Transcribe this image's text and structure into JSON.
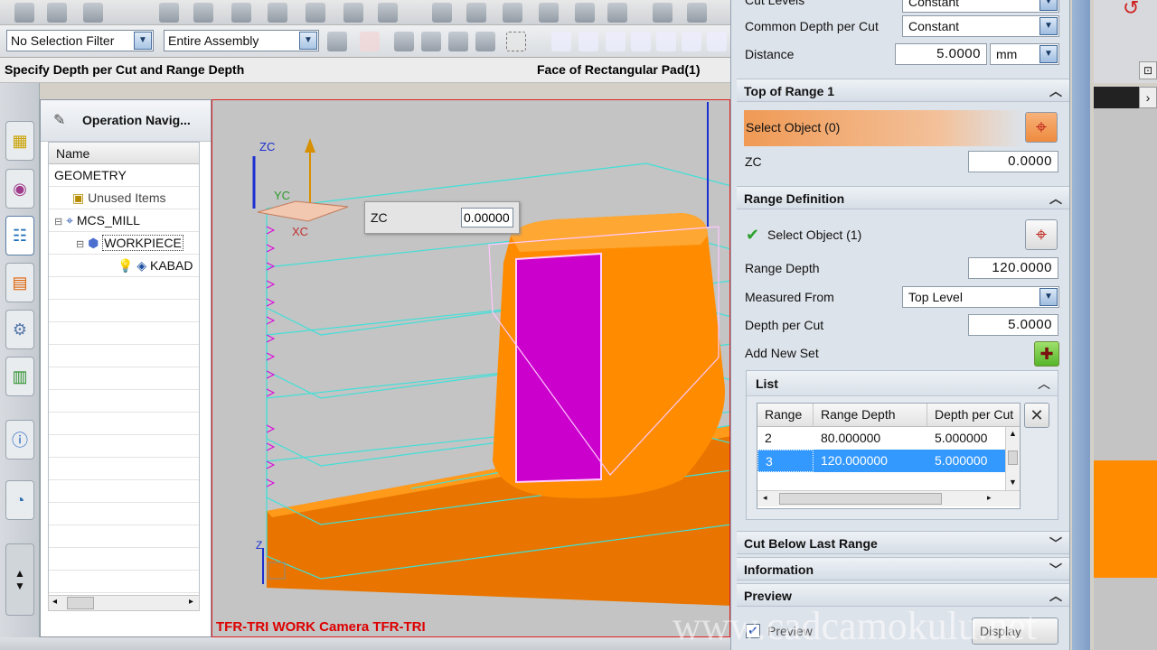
{
  "toolbar": {
    "selection_filter": "No Selection Filter",
    "assembly_scope": "Entire Assembly"
  },
  "cue_line": {
    "prompt": "Specify Depth per Cut and Range Depth",
    "selection": "Face of Rectangular Pad(1)"
  },
  "navigator": {
    "title": "Operation Navig...",
    "column_name": "Name",
    "rows": [
      {
        "label": "GEOMETRY"
      },
      {
        "label": "Unused Items"
      },
      {
        "label": "MCS_MILL"
      },
      {
        "label": "WORKPIECE"
      },
      {
        "label": "KABAD"
      }
    ]
  },
  "viewport": {
    "axis_zc": "ZC",
    "axis_yc": "YC",
    "axis_xc": "XC",
    "axis_z": "Z",
    "footer": "TFR-TRI WORK Camera TFR-TRI",
    "popup": {
      "label": "ZC",
      "value": "0.00000"
    }
  },
  "dialog": {
    "cut_levels_label": "Cut Levels",
    "cut_levels_value": "Constant",
    "common_depth_label": "Common Depth per Cut",
    "common_depth_value": "Constant",
    "distance_label": "Distance",
    "distance_value": "5.0000",
    "distance_unit": "mm",
    "top_of_range": {
      "title": "Top of Range 1",
      "select_label": "Select Object (0)",
      "zc_label": "ZC",
      "zc_value": "0.0000"
    },
    "range_definition": {
      "title": "Range Definition",
      "select_label": "Select Object (1)",
      "range_depth_label": "Range Depth",
      "range_depth_value": "120.0000",
      "measured_from_label": "Measured From",
      "measured_from_value": "Top Level",
      "depth_per_cut_label": "Depth per Cut",
      "depth_per_cut_value": "5.0000",
      "add_new_set_label": "Add New Set"
    },
    "list": {
      "title": "List",
      "columns": [
        "Range",
        "Range Depth",
        "Depth per Cut"
      ],
      "rows": [
        {
          "range": "2",
          "range_depth": "80.000000",
          "depth_per_cut": "5.000000",
          "selected": false
        },
        {
          "range": "3",
          "range_depth": "120.000000",
          "depth_per_cut": "5.000000",
          "selected": true
        }
      ]
    },
    "cut_below_last_range": "Cut Below Last Range",
    "information": "Information",
    "preview": "Preview",
    "preview_checkbox": "Preview",
    "display_button": "Display"
  },
  "watermark": "www.cadcamokulu.net",
  "colors": {
    "part_orange": "#ff8c00",
    "selected_face_magenta": "#cc00cc",
    "toolpath_cyan": "#3fe0d8",
    "select_highlight": "#f0a060",
    "selection_blue": "#3399ff"
  }
}
